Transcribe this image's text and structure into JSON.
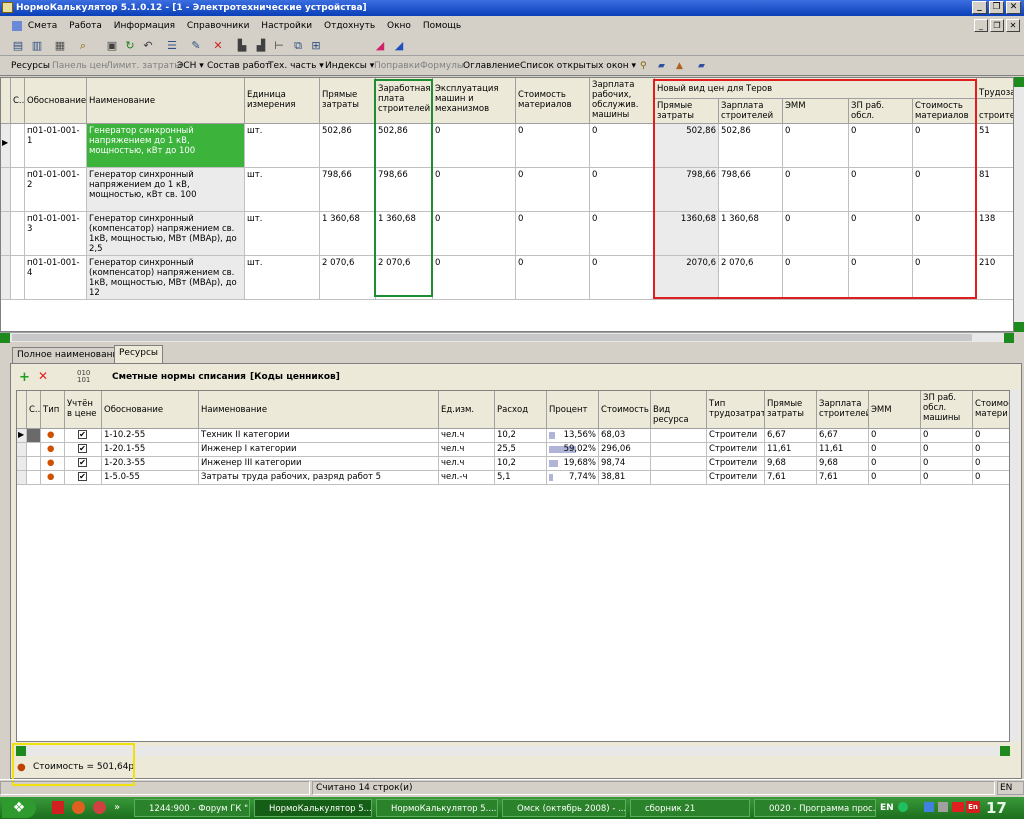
{
  "window": {
    "title": "НормоКалькулятор  5.1.0.12  - [1 - Электротехнические устройства]"
  },
  "menu": [
    "Смета",
    "Работа",
    "Информация",
    "Справочники",
    "Настройки",
    "Отдохнуть",
    "Окно",
    "Помощь"
  ],
  "toolbar2": [
    "Ресурсы",
    "Панель цен",
    "Лимит. затраты",
    "ЭСН ▾",
    "Состав работ",
    "Тех. часть ▾",
    "Индексы ▾",
    "Поправки",
    "Формулы",
    "Оглавление",
    "Список открытых окон ▾"
  ],
  "top_grid": {
    "headers": {
      "c": "С..",
      "base": "Обоснование",
      "name": "Наименование",
      "unit": "Единица измерения",
      "direct": "Прямые затраты",
      "salary": "Заработная плата строителей",
      "exploit": "Эксплуатация машин и механизмов",
      "materials": "Стоимость материалов",
      "mach_salary": "Зарплата рабочих, обслужив. машины",
      "group": "Новый вид цен для Теров",
      "g_direct": "Прямые затраты",
      "g_salary": "Зарплата строителей",
      "g_emm": "ЭММ",
      "g_zp": "ЗП раб. обсл. машины",
      "g_mat": "Стоимость материалов",
      "labor": "Трудоза",
      "labor2": "строите"
    },
    "rows": [
      {
        "base": "п01-01-001-1",
        "name": "Генератор синхронный напряжением до 1 кВ, мощностью, кВт до 100",
        "unit": "шт.",
        "direct": "502,86",
        "salary": "502,86",
        "exploit": "0",
        "materials": "0",
        "mach_salary": "0",
        "g_direct": "502,86",
        "g_salary": "502,86",
        "g_emm": "0",
        "g_zp": "0",
        "g_mat": "0",
        "labor": "51"
      },
      {
        "base": "п01-01-001-2",
        "name": "Генератор синхронный напряжением до 1 кВ, мощностью, кВт св. 100",
        "unit": "шт.",
        "direct": "798,66",
        "salary": "798,66",
        "exploit": "0",
        "materials": "0",
        "mach_salary": "0",
        "g_direct": "798,66",
        "g_salary": "798,66",
        "g_emm": "0",
        "g_zp": "0",
        "g_mat": "0",
        "labor": "81"
      },
      {
        "base": "п01-01-001-3",
        "name": "Генератор синхронный (компенсатор) напряжением св. 1кВ, мощностью, МВт (МВАр), до 2,5",
        "unit": "шт.",
        "direct": "1 360,68",
        "salary": "1 360,68",
        "exploit": "0",
        "materials": "0",
        "mach_salary": "0",
        "g_direct": "1360,68",
        "g_salary": "1 360,68",
        "g_emm": "0",
        "g_zp": "0",
        "g_mat": "0",
        "labor": "138"
      },
      {
        "base": "п01-01-001-4",
        "name": "Генератор синхронный (компенсатор) напряжением св. 1кВ, мощностью, МВт (МВАр), до 12",
        "unit": "шт.",
        "direct": "2 070,6",
        "salary": "2 070,6",
        "exploit": "0",
        "materials": "0",
        "mach_salary": "0",
        "g_direct": "2070,6",
        "g_salary": "2 070,6",
        "g_emm": "0",
        "g_zp": "0",
        "g_mat": "0",
        "labor": "210"
      }
    ]
  },
  "tabs": [
    "Полное наименование",
    "Ресурсы"
  ],
  "res_toolbar": {
    "title": "Сметные нормы списания",
    "codes": "[Коды ценников]"
  },
  "res_grid": {
    "headers": {
      "c": "С..",
      "type": "Тип",
      "inprice": "Учтён в цене",
      "base": "Обоснование",
      "name": "Наименование",
      "unit": "Ед.изм.",
      "rate": "Расход",
      "pct": "Процент",
      "cost": "Стоимость",
      "kind": "Вид ресурса",
      "ltype": "Тип трудозатрат",
      "direct": "Прямые затраты",
      "salary": "Зарплата строителей",
      "emm": "ЭММ",
      "zp": "ЗП раб. обсл. машины",
      "mat": "Стоимос матери"
    },
    "rows": [
      {
        "base": "1-10.2-55",
        "name": "Техник II категории",
        "unit": "чел.ч",
        "rate": "10,2",
        "pct": "13,56%",
        "pctv": 13.56,
        "cost": "68,03",
        "kind": "",
        "ltype": "Строители",
        "direct": "6,67",
        "salary": "6,67",
        "emm": "0",
        "zp": "0",
        "mat": "0"
      },
      {
        "base": "1-20.1-55",
        "name": "Инженер I категории",
        "unit": "чел.ч",
        "rate": "25,5",
        "pct": "59,02%",
        "pctv": 59.02,
        "cost": "296,06",
        "kind": "",
        "ltype": "Строители",
        "direct": "11,61",
        "salary": "11,61",
        "emm": "0",
        "zp": "0",
        "mat": "0"
      },
      {
        "base": "1-20.3-55",
        "name": "Инженер III категории",
        "unit": "чел.ч",
        "rate": "10,2",
        "pct": "19,68%",
        "pctv": 19.68,
        "cost": "98,74",
        "kind": "",
        "ltype": "Строители",
        "direct": "9,68",
        "salary": "9,68",
        "emm": "0",
        "zp": "0",
        "mat": "0"
      },
      {
        "base": "1-5.0-55",
        "name": "Затраты труда рабочих, разряд работ 5",
        "unit": "чел.-ч",
        "rate": "5,1",
        "pct": "7,74%",
        "pctv": 7.74,
        "cost": "38,81",
        "kind": "",
        "ltype": "Строители",
        "direct": "7,61",
        "salary": "7,61",
        "emm": "0",
        "zp": "0",
        "mat": "0"
      }
    ]
  },
  "cost_label": "Стоимость = 501,64р",
  "status": {
    "count": "Считано 14 строк(и)",
    "lang": "EN"
  },
  "taskbar": {
    "items": [
      "1244:900 - Форум ГК \" ...",
      "НормоКалькулятор 5...",
      "НормоКалькулятор 5....",
      "Омск (октябрь 2008) - ...",
      "сборник 21",
      "0020 - Программа прос..."
    ],
    "lang": "EN",
    "clock": "17"
  }
}
